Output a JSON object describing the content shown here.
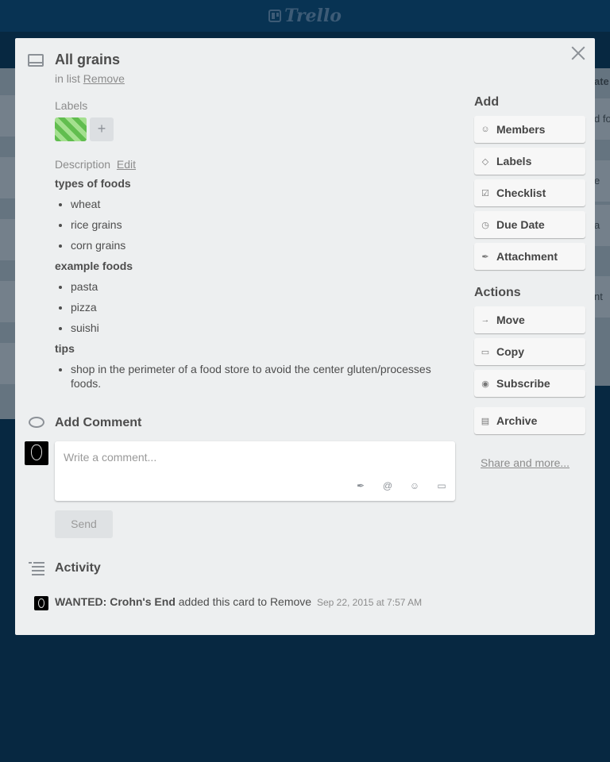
{
  "app": {
    "logo_text": "Trello"
  },
  "background": {
    "right_card_snippets": [
      "ate",
      "d fo",
      "e",
      "a",
      "nt"
    ]
  },
  "card": {
    "title": "All grains",
    "in_list_prefix": "in list",
    "list_name": "Remove",
    "labels_heading": "Labels",
    "label_color": "#61bd4f",
    "label_add_symbol": "+",
    "description_heading": "Description",
    "description_edit": "Edit",
    "description": {
      "section1_title": "types of foods",
      "section1_items": [
        "wheat",
        "rice grains",
        "corn grains"
      ],
      "section2_title": "example foods",
      "section2_items": [
        "pasta",
        "pizza",
        "suishi"
      ],
      "section3_title": "tips",
      "section3_items": [
        "shop in the perimeter of a food store to avoid the center gluten/processes foods."
      ]
    }
  },
  "comment": {
    "heading": "Add Comment",
    "placeholder": "Write a comment...",
    "send_label": "Send",
    "tools": [
      "attachment-icon",
      "mention-icon",
      "emoji-icon",
      "card-icon"
    ]
  },
  "activity": {
    "heading": "Activity",
    "user": "WANTED: Crohn's End",
    "action": "added this card to Remove",
    "date": "Sep 22, 2015 at 7:57 AM"
  },
  "sidebar": {
    "add_heading": "Add",
    "add_buttons": [
      "Members",
      "Labels",
      "Checklist",
      "Due Date",
      "Attachment"
    ],
    "actions_heading": "Actions",
    "action_buttons": [
      "Move",
      "Copy",
      "Subscribe",
      "Archive"
    ],
    "share_link": "Share and more..."
  }
}
